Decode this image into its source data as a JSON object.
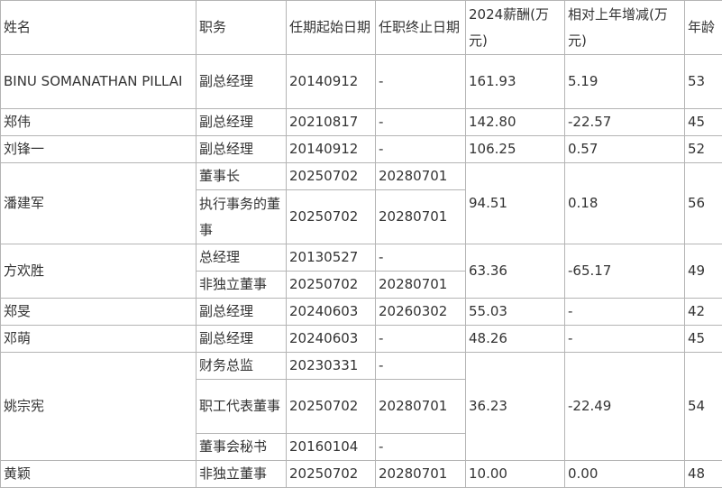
{
  "headers": {
    "name": "姓名",
    "position": "职务",
    "start": "任期起始日期",
    "end": "任职终止日期",
    "pay": "2024薪酬(万元)",
    "change": "相对上年增减(万元)",
    "age": "年龄"
  },
  "rows": [
    {
      "name": "BINU SOMANATHAN PILLAI",
      "position": "副总经理",
      "start": "20140912",
      "end": "-",
      "pay": "161.93",
      "change": "5.19",
      "age": "53"
    },
    {
      "name": "郑伟",
      "position": "副总经理",
      "start": "20210817",
      "end": "-",
      "pay": "142.80",
      "change": "-22.57",
      "age": "45"
    },
    {
      "name": "刘锋一",
      "position": "副总经理",
      "start": "20140912",
      "end": "-",
      "pay": "106.25",
      "change": "0.57",
      "age": "52"
    },
    {
      "name": "潘建军",
      "pay": "94.51",
      "change": "0.18",
      "age": "56",
      "roles": [
        {
          "position": "董事长",
          "start": "20250702",
          "end": "20280701"
        },
        {
          "position": "执行事务的董事",
          "start": "20250702",
          "end": "20280701"
        }
      ]
    },
    {
      "name": "方欢胜",
      "pay": "63.36",
      "change": "-65.17",
      "age": "49",
      "roles": [
        {
          "position": "总经理",
          "start": "20130527",
          "end": "-"
        },
        {
          "position": "非独立董事",
          "start": "20250702",
          "end": "20280701"
        }
      ]
    },
    {
      "name": "郑旻",
      "position": "副总经理",
      "start": "20240603",
      "end": "20260302",
      "pay": "55.03",
      "change": "-",
      "age": "42"
    },
    {
      "name": "邓萌",
      "position": "副总经理",
      "start": "20240603",
      "end": "-",
      "pay": "48.26",
      "change": "-",
      "age": "45"
    },
    {
      "name": "姚宗宪",
      "pay": "36.23",
      "change": "-22.49",
      "age": "54",
      "roles": [
        {
          "position": "财务总监",
          "start": "20230331",
          "end": "-"
        },
        {
          "position": "职工代表董事",
          "start": "20250702",
          "end": "20280701"
        },
        {
          "position": "董事会秘书",
          "start": "20160104",
          "end": "-"
        }
      ]
    },
    {
      "name": "黄颖",
      "position": "非独立董事",
      "start": "20250702",
      "end": "20280701",
      "pay": "10.00",
      "change": "0.00",
      "age": "48"
    }
  ]
}
